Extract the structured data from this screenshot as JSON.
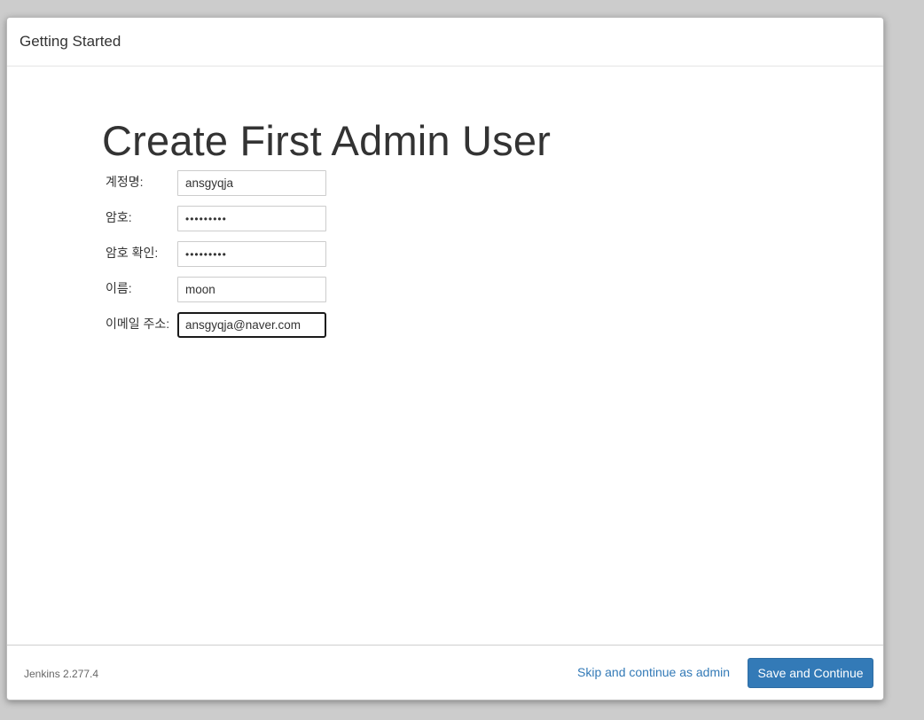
{
  "dialog": {
    "title": "Getting Started"
  },
  "page": {
    "heading": "Create First Admin User"
  },
  "form": {
    "fields": [
      {
        "label": "계정명:",
        "value": "ansgyqja",
        "type": "text"
      },
      {
        "label": "암호:",
        "value": "•••••••••",
        "type": "password"
      },
      {
        "label": "암호 확인:",
        "value": "•••••••••",
        "type": "password"
      },
      {
        "label": "이름:",
        "value": "moon",
        "type": "text"
      },
      {
        "label": "이메일 주소:",
        "value": "ansgyqja@naver.com",
        "type": "text",
        "focused": true
      }
    ]
  },
  "footer": {
    "version": "Jenkins 2.277.4",
    "skip_label": "Skip and continue as admin",
    "save_label": "Save and Continue"
  },
  "colors": {
    "primary": "#337ab7",
    "link": "#337ab7",
    "background": "#cccccc"
  }
}
